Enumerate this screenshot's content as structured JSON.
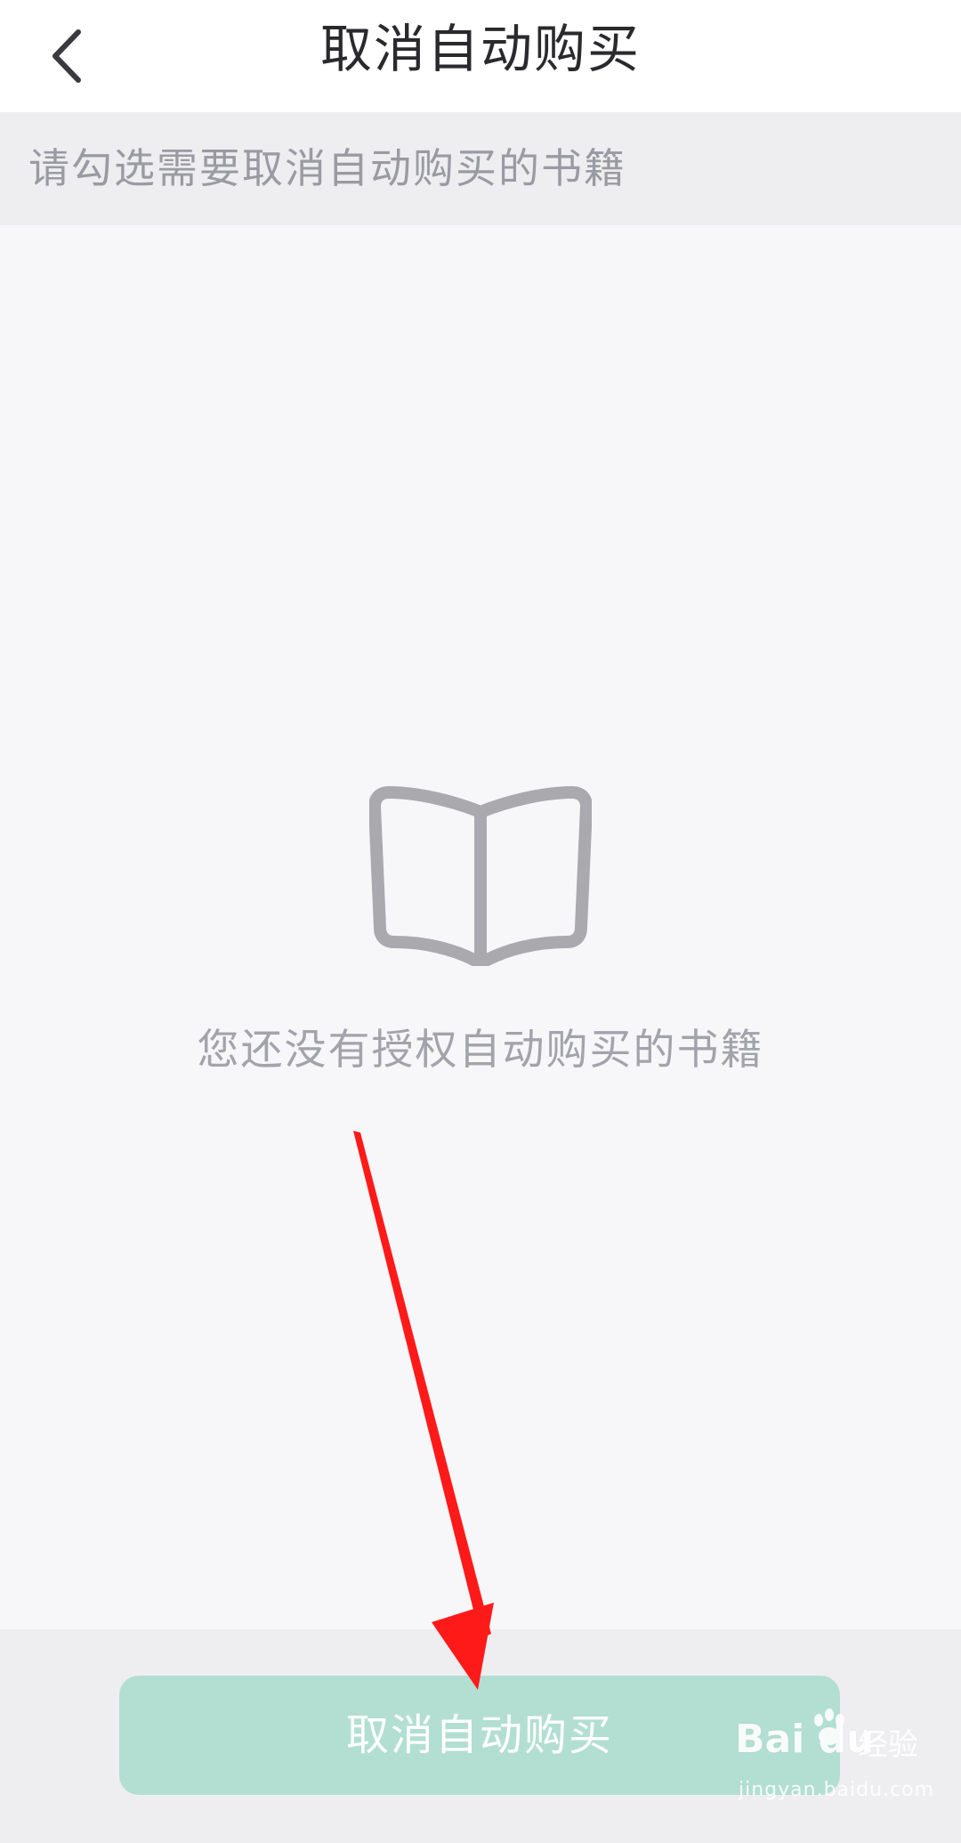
{
  "header": {
    "title": "取消自动购买",
    "back_icon": "chevron-left-icon"
  },
  "hint": {
    "text": "请勾选需要取消自动购买的书籍"
  },
  "empty_state": {
    "icon": "open-book-icon",
    "message": "您还没有授权自动购买的书籍"
  },
  "footer": {
    "cancel_button_label": "取消自动购买",
    "button_color": "#b2dfd1"
  },
  "annotation": {
    "arrow_color": "#ff1a1a"
  },
  "watermark": {
    "brand": "Bai du",
    "product": "经验",
    "url": "jingyan.baidu.com"
  },
  "colors": {
    "title_text": "#2a2a2e",
    "hint_text": "#9a9aa2",
    "background": "#f7f7f9",
    "hint_background": "#eeeef1"
  }
}
